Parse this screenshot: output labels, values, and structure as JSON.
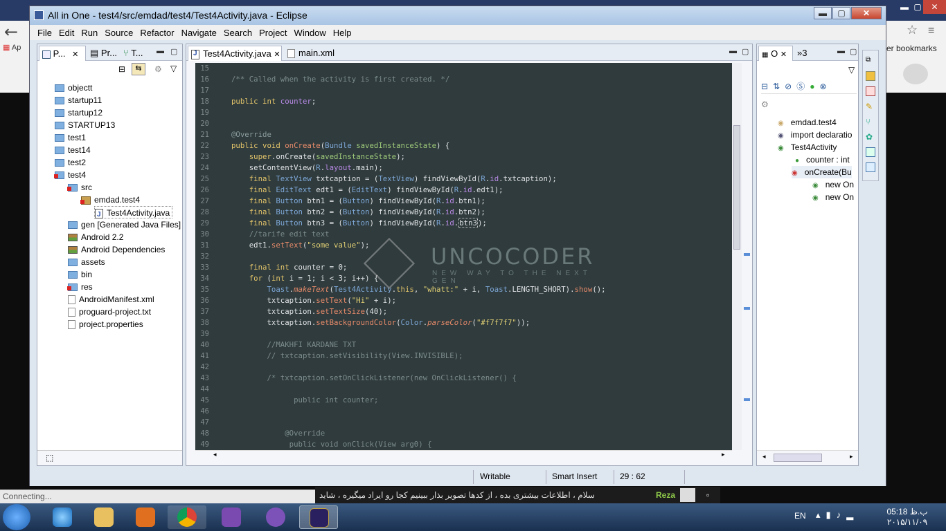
{
  "chrome": {
    "back_icon": "back-arrow-icon",
    "apps_label": "Ap",
    "bookmarks_label": "er bookmarks",
    "status": "Connecting..."
  },
  "chat": {
    "name": "Reza",
    "message": "سلام ، اطلاعات بیشتری بده ، از کدها تصویر بذار ببینیم کجا رو ایراد میگیره ، شاید"
  },
  "window": {
    "title": "All in One - test4/src/emdad/test4/Test4Activity.java - Eclipse",
    "min": "▬",
    "max": "▢",
    "close": "✕"
  },
  "menu": [
    "File",
    "Edit",
    "Run",
    "Source",
    "Refactor",
    "Navigate",
    "Search",
    "Project",
    "Window",
    "Help"
  ],
  "package_explorer": {
    "tabs": [
      "P...",
      "Pr...",
      "T..."
    ],
    "items": [
      {
        "label": "objectt",
        "type": "folder"
      },
      {
        "label": "startup11",
        "type": "folder"
      },
      {
        "label": "startup12",
        "type": "folder"
      },
      {
        "label": "STARTUP13",
        "type": "folder"
      },
      {
        "label": "test1",
        "type": "folder"
      },
      {
        "label": "test14",
        "type": "folder"
      },
      {
        "label": "test2",
        "type": "folder"
      },
      {
        "label": "test4",
        "type": "folder"
      },
      {
        "label": "src",
        "type": "folder"
      },
      {
        "label": "emdad.test4",
        "type": "package"
      },
      {
        "label": "Test4Activity.java",
        "type": "java"
      },
      {
        "label": "gen [Generated Java Files]",
        "type": "folder"
      },
      {
        "label": "Android 2.2",
        "type": "lib"
      },
      {
        "label": "Android Dependencies",
        "type": "lib"
      },
      {
        "label": "assets",
        "type": "folder"
      },
      {
        "label": "bin",
        "type": "folder"
      },
      {
        "label": "res",
        "type": "folder"
      },
      {
        "label": "AndroidManifest.xml",
        "type": "file"
      },
      {
        "label": "proguard-project.txt",
        "type": "file"
      },
      {
        "label": "project.properties",
        "type": "file"
      }
    ]
  },
  "editor": {
    "tabs": [
      "Test4Activity.java",
      "main.xml"
    ],
    "line_numbers": [
      "15",
      "16",
      "17",
      "18",
      "19",
      "20",
      "21",
      "22",
      "23",
      "24",
      "25",
      "26",
      "27",
      "28",
      "29",
      "30",
      "31",
      "32",
      "33",
      "34",
      "35",
      "36",
      "37",
      "38",
      "39",
      "40",
      "41",
      "42",
      "43",
      "44",
      "45",
      "46",
      "47",
      "48",
      "49"
    ],
    "watermark": {
      "title": "UNCOCODER",
      "subtitle": "NEW WAY TO THE NEXT GEN"
    }
  },
  "outline": {
    "tabs": [
      "O",
      "»3"
    ],
    "items": [
      "emdad.test4",
      "import declaratio",
      "Test4Activity",
      "counter : int",
      "onCreate(Bu",
      "new On",
      "new On"
    ]
  },
  "status": {
    "writable": "Writable",
    "insert": "Smart Insert",
    "position": "29 : 62"
  },
  "tray": {
    "language": "EN",
    "time": "05:18 ب.ظ",
    "date": "۲۰۱۵/۱۱/۰۹"
  },
  "colors": {
    "editor_bg": "#2f3b3d",
    "keyword": "#e3c46a",
    "type": "#7ea8d8",
    "comment": "#7d8c8e"
  }
}
